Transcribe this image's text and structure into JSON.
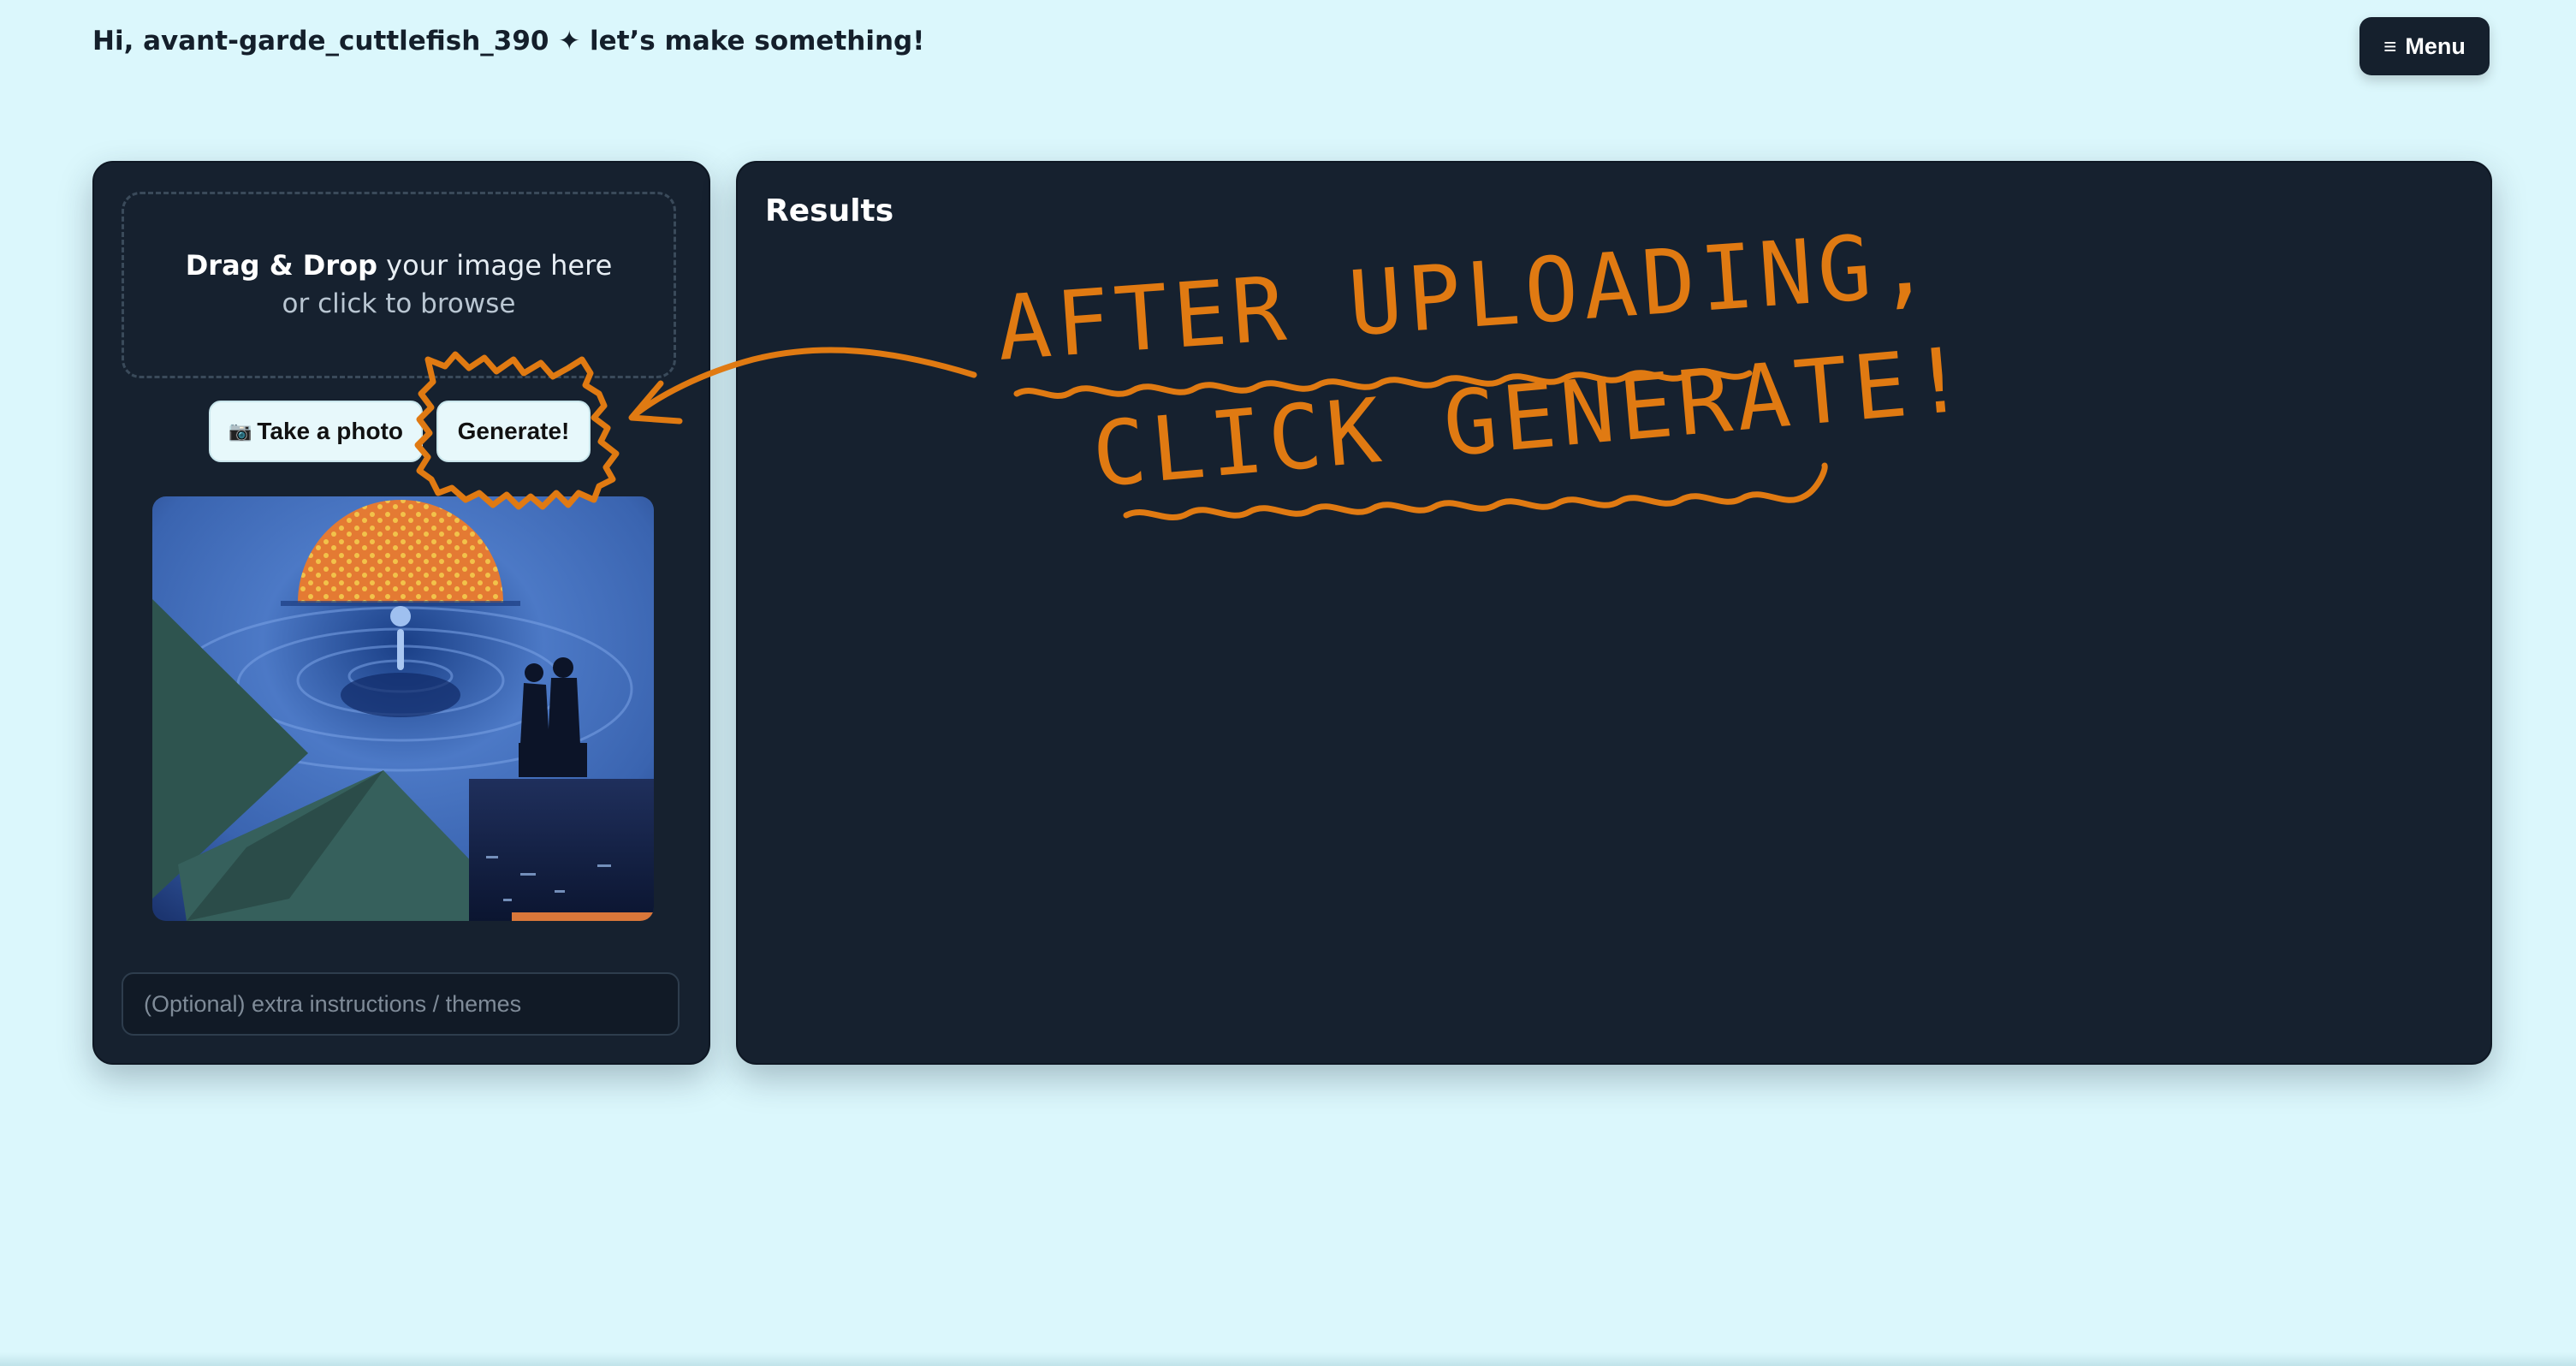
{
  "header": {
    "greeting": "Hi, avant-garde_cuttlefish_390 ✦ let’s make something!",
    "menu_icon": "≡",
    "menu_label": "Menu"
  },
  "upload": {
    "drop_bold": "Drag & Drop",
    "drop_rest": " your image here",
    "drop_line2": "or click to browse",
    "take_photo_icon": "📷",
    "take_photo_label": "Take a photo",
    "generate_label": "Generate!",
    "instructions_placeholder": "(Optional) extra instructions / themes"
  },
  "results": {
    "title": "Results"
  },
  "annotation": {
    "line1": "AFTER UPLOADING,",
    "line2": "CLICK GENERATE!"
  },
  "colors": {
    "background": "#dbf7fc",
    "panel": "#16212f",
    "accent_orange": "#e07a12",
    "button_light": "#e7f8fb"
  }
}
